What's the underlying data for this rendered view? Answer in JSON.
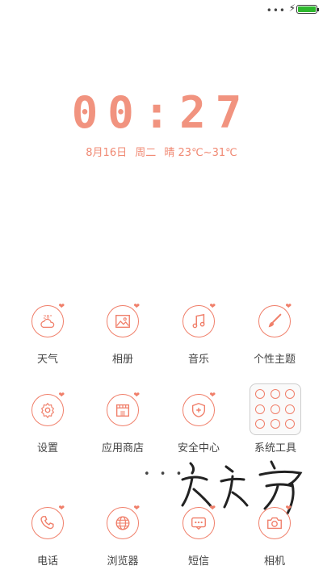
{
  "status": {
    "signal": "•••",
    "battery_color": "#2eb82e"
  },
  "clock": {
    "time": "00:27"
  },
  "date": {
    "day": "8月16日",
    "weekday": "周二",
    "weather": "晴 23℃~31℃"
  },
  "weather_icon_text": "28°",
  "apps": [
    {
      "label": "天气",
      "icon": "weather-icon"
    },
    {
      "label": "相册",
      "icon": "gallery-icon"
    },
    {
      "label": "音乐",
      "icon": "music-icon"
    },
    {
      "label": "个性主题",
      "icon": "theme-brush-icon"
    },
    {
      "label": "设置",
      "icon": "settings-gear-icon"
    },
    {
      "label": "应用商店",
      "icon": "app-store-icon"
    },
    {
      "label": "安全中心",
      "icon": "security-shield-icon"
    },
    {
      "label": "系统工具",
      "icon": "folder-icon"
    },
    {
      "label": "电话",
      "icon": "phone-icon"
    },
    {
      "label": "浏览器",
      "icon": "browser-globe-icon"
    },
    {
      "label": "短信",
      "icon": "message-icon"
    },
    {
      "label": "相机",
      "icon": "camera-icon"
    }
  ],
  "page_indicator": "• • •",
  "accent_color": "#f07f6a"
}
